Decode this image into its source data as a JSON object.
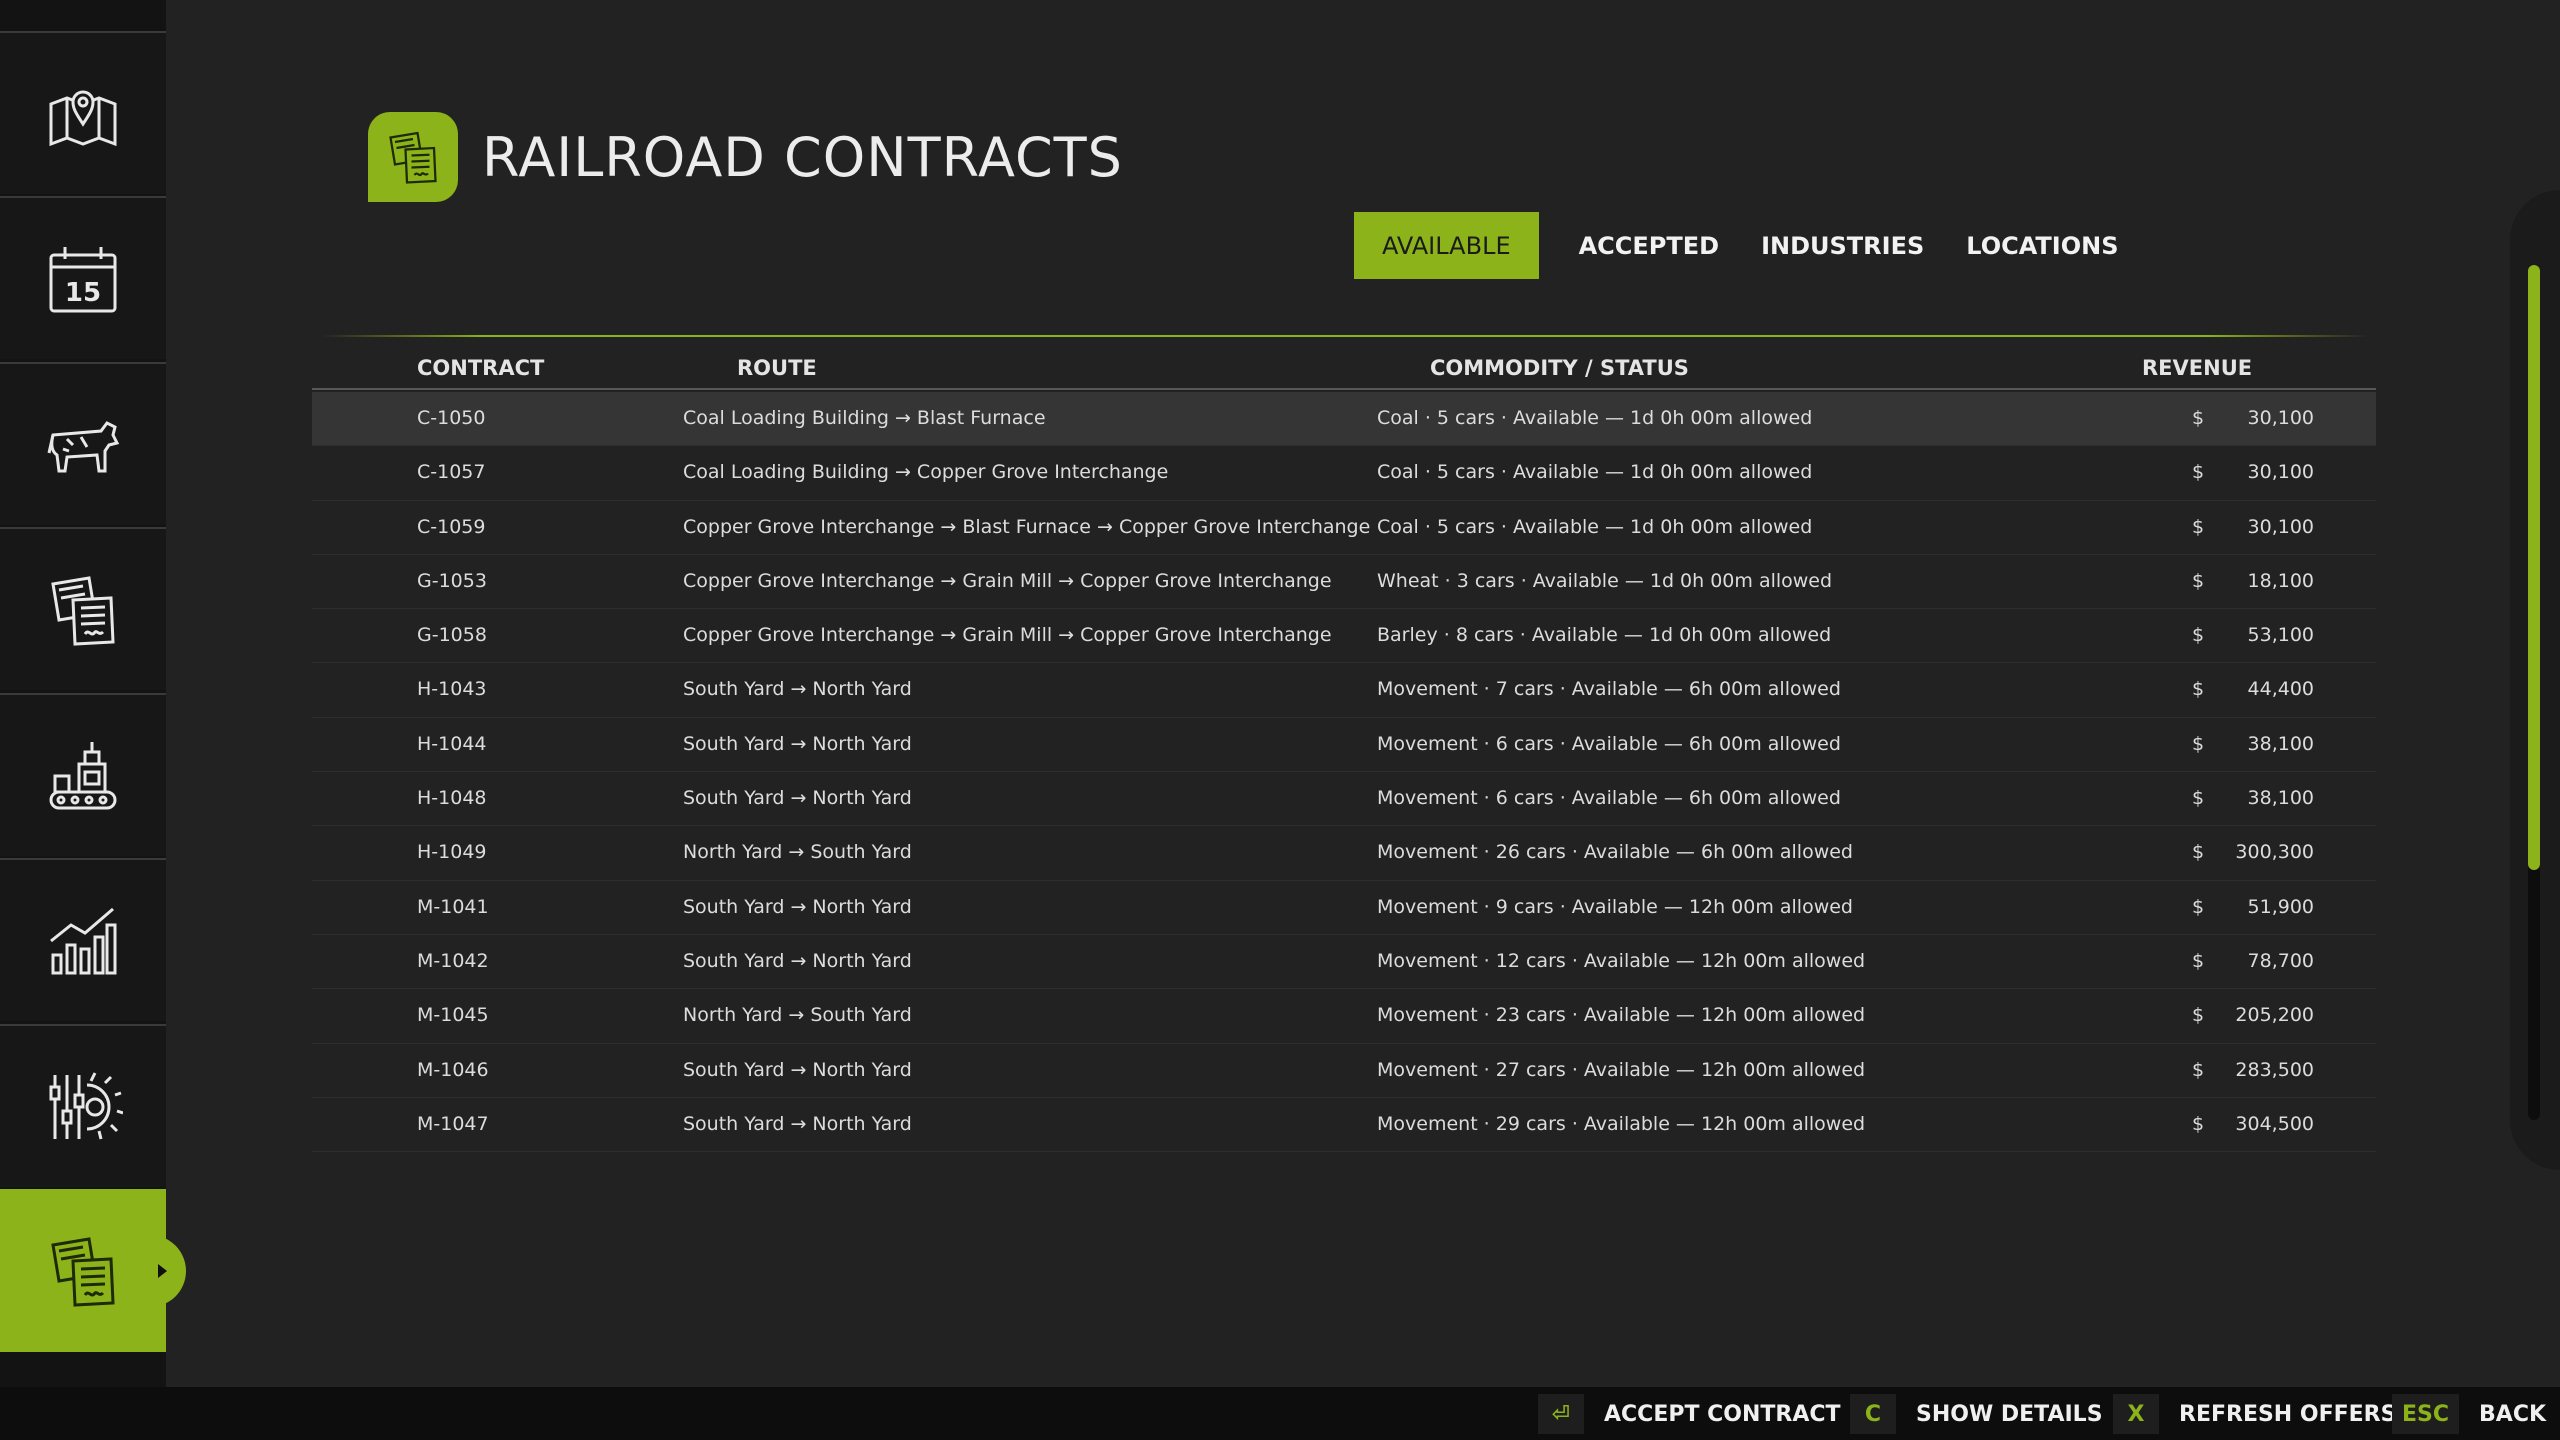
{
  "header": {
    "title": "RAILROAD CONTRACTS"
  },
  "tabs": [
    "AVAILABLE",
    "ACCEPTED",
    "INDUSTRIES",
    "LOCATIONS"
  ],
  "table": {
    "columns": [
      "CONTRACT",
      "ROUTE",
      "COMMODITY / STATUS",
      "REVENUE"
    ],
    "rows": [
      {
        "id": "C-1050",
        "route": "Coal Loading Building → Blast Furnace",
        "status": "Coal · 5 cars · Available — 1d 0h 00m allowed",
        "currency": "$",
        "revenue": "30,100"
      },
      {
        "id": "C-1057",
        "route": "Coal Loading Building → Copper Grove Interchange",
        "status": "Coal · 5 cars · Available — 1d 0h 00m allowed",
        "currency": "$",
        "revenue": "30,100"
      },
      {
        "id": "C-1059",
        "route": "Copper Grove Interchange → Blast Furnace → Copper Grove Interchange",
        "status": "Coal · 5 cars · Available — 1d 0h 00m allowed",
        "currency": "$",
        "revenue": "30,100"
      },
      {
        "id": "G-1053",
        "route": "Copper Grove Interchange → Grain Mill → Copper Grove Interchange",
        "status": "Wheat · 3 cars · Available — 1d 0h 00m allowed",
        "currency": "$",
        "revenue": "18,100"
      },
      {
        "id": "G-1058",
        "route": "Copper Grove Interchange → Grain Mill → Copper Grove Interchange",
        "status": "Barley · 8 cars · Available — 1d 0h 00m allowed",
        "currency": "$",
        "revenue": "53,100"
      },
      {
        "id": "H-1043",
        "route": "South Yard → North Yard",
        "status": "Movement · 7 cars · Available — 6h 00m allowed",
        "currency": "$",
        "revenue": "44,400"
      },
      {
        "id": "H-1044",
        "route": "South Yard → North Yard",
        "status": "Movement · 6 cars · Available — 6h 00m allowed",
        "currency": "$",
        "revenue": "38,100"
      },
      {
        "id": "H-1048",
        "route": "South Yard → North Yard",
        "status": "Movement · 6 cars · Available — 6h 00m allowed",
        "currency": "$",
        "revenue": "38,100"
      },
      {
        "id": "H-1049",
        "route": "North Yard → South Yard",
        "status": "Movement · 26 cars · Available — 6h 00m allowed",
        "currency": "$",
        "revenue": "300,300"
      },
      {
        "id": "M-1041",
        "route": "South Yard → North Yard",
        "status": "Movement · 9 cars · Available — 12h 00m allowed",
        "currency": "$",
        "revenue": "51,900"
      },
      {
        "id": "M-1042",
        "route": "South Yard → North Yard",
        "status": "Movement · 12 cars · Available — 12h 00m allowed",
        "currency": "$",
        "revenue": "78,700"
      },
      {
        "id": "M-1045",
        "route": "North Yard → South Yard",
        "status": "Movement · 23 cars · Available — 12h 00m allowed",
        "currency": "$",
        "revenue": "205,200"
      },
      {
        "id": "M-1046",
        "route": "South Yard → North Yard",
        "status": "Movement · 27 cars · Available — 12h 00m allowed",
        "currency": "$",
        "revenue": "283,500"
      },
      {
        "id": "M-1047",
        "route": "South Yard → North Yard",
        "status": "Movement · 29 cars · Available — 12h 00m allowed",
        "currency": "$",
        "revenue": "304,500"
      }
    ]
  },
  "footer": {
    "hints": [
      {
        "key": "⏎",
        "label": "ACCEPT CONTRACT"
      },
      {
        "key": "C",
        "label": "SHOW DETAILS"
      },
      {
        "key": "X",
        "label": "REFRESH OFFERS"
      },
      {
        "key": "ESC",
        "label": "BACK"
      }
    ]
  },
  "colors": {
    "accent": "#8cb31a",
    "background": "#222222",
    "sidebar": "#131313"
  },
  "sidebar_icons": [
    "map-icon",
    "calendar-icon",
    "animals-icon",
    "contracts-icon",
    "production-icon",
    "statistics-icon",
    "settings-icon",
    "contracts-icon"
  ],
  "calendar_day": "15",
  "scroll_position": 0.0
}
